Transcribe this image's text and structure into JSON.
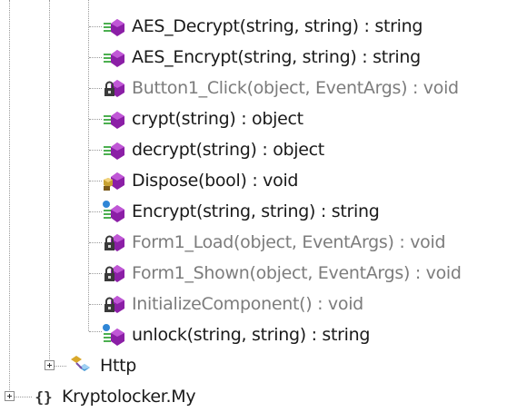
{
  "methods": [
    {
      "label": "AES_Decrypt(string, string) : string",
      "icon": "public-method-icon",
      "access": "public"
    },
    {
      "label": "AES_Encrypt(string, string) : string",
      "icon": "public-method-icon",
      "access": "public"
    },
    {
      "label": "Button1_Click(object, EventArgs) : void",
      "icon": "private-method-icon",
      "access": "private"
    },
    {
      "label": "crypt(string) : object",
      "icon": "public-method-icon",
      "access": "public"
    },
    {
      "label": "decrypt(string) : object",
      "icon": "public-method-icon",
      "access": "public"
    },
    {
      "label": "Dispose(bool) : void",
      "icon": "protected-override-method-icon",
      "access": "public"
    },
    {
      "label": "Encrypt(string, string) : string",
      "icon": "public-static-method-icon",
      "access": "public"
    },
    {
      "label": "Form1_Load(object, EventArgs) : void",
      "icon": "private-method-icon",
      "access": "private"
    },
    {
      "label": "Form1_Shown(object, EventArgs) : void",
      "icon": "private-method-icon",
      "access": "private"
    },
    {
      "label": "InitializeComponent() : void",
      "icon": "private-method-icon",
      "access": "private"
    },
    {
      "label": "unlock(string, string) : string",
      "icon": "public-static-method-icon",
      "access": "public"
    }
  ],
  "class_node": {
    "label": "Http",
    "icon": "class-icon"
  },
  "namespace_node": {
    "label": "Kryptolocker.My",
    "icon": "namespace-icon"
  },
  "colors": {
    "public_text": "#1a1a1a",
    "private_text": "#7c7c7c",
    "method_purple": "#8b1fa6",
    "method_green": "#4caf50"
  }
}
